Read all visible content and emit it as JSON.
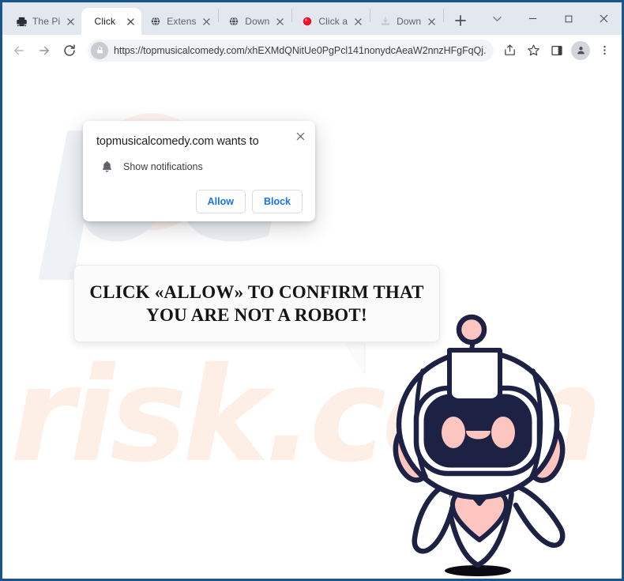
{
  "window": {
    "controls": [
      {
        "name": "tab-search",
        "glyph": "chevron-down-icon"
      },
      {
        "name": "minimize",
        "glyph": "minimize-icon"
      },
      {
        "name": "maximize",
        "glyph": "maximize-icon"
      },
      {
        "name": "close",
        "glyph": "close-icon"
      }
    ]
  },
  "tabs": [
    {
      "label": "The Pi",
      "favicon": "printer-icon",
      "active": false
    },
    {
      "label": "Click ",
      "favicon": "none",
      "active": true
    },
    {
      "label": "Extens",
      "favicon": "globe-icon",
      "active": false
    },
    {
      "label": "Down",
      "favicon": "globe-icon",
      "active": false
    },
    {
      "label": "Click a",
      "favicon": "red-dot-icon",
      "active": false
    },
    {
      "label": "Down",
      "favicon": "download-icon",
      "active": false
    }
  ],
  "new_tab_label": "+",
  "toolbar": {
    "back_label": "Back",
    "forward_label": "Forward",
    "reload_label": "Reload",
    "url": "https://topmusicalcomedy.com/xhEXMdQNitUe0PgPcl141nonydcAeaW2nnzHFgFqQj...",
    "url_domain": "topmusicalcomedy.com",
    "share_label": "Share",
    "bookmark_label": "Bookmark this tab",
    "side_panel_label": "Side panel",
    "profile_label": "Profile",
    "menu_label": "Customize and control Google Chrome"
  },
  "dialog": {
    "title": "topmusicalcomedy.com wants to",
    "permission_label": "Show notifications",
    "permission_icon": "bell-icon",
    "allow_label": "Allow",
    "block_label": "Block",
    "close_label": "Close"
  },
  "page": {
    "bubble_line1": "CLICK «ALLOW» TO CONFIRM THAT",
    "bubble_line2": "YOU ARE NOT A ROBOT!",
    "watermark_top": "pc",
    "watermark_bottom": "risk.com",
    "mascot_name": "robot-mascot"
  },
  "colors": {
    "window_border": "#17558f",
    "tabstrip_bg": "#e3e8ef",
    "accent_blue": "#1a73e8",
    "robot_outline": "#1d2143",
    "robot_pink": "#fcc5c0",
    "watermark_blue": "#eef1f6",
    "watermark_peach": "#fdeee6"
  }
}
